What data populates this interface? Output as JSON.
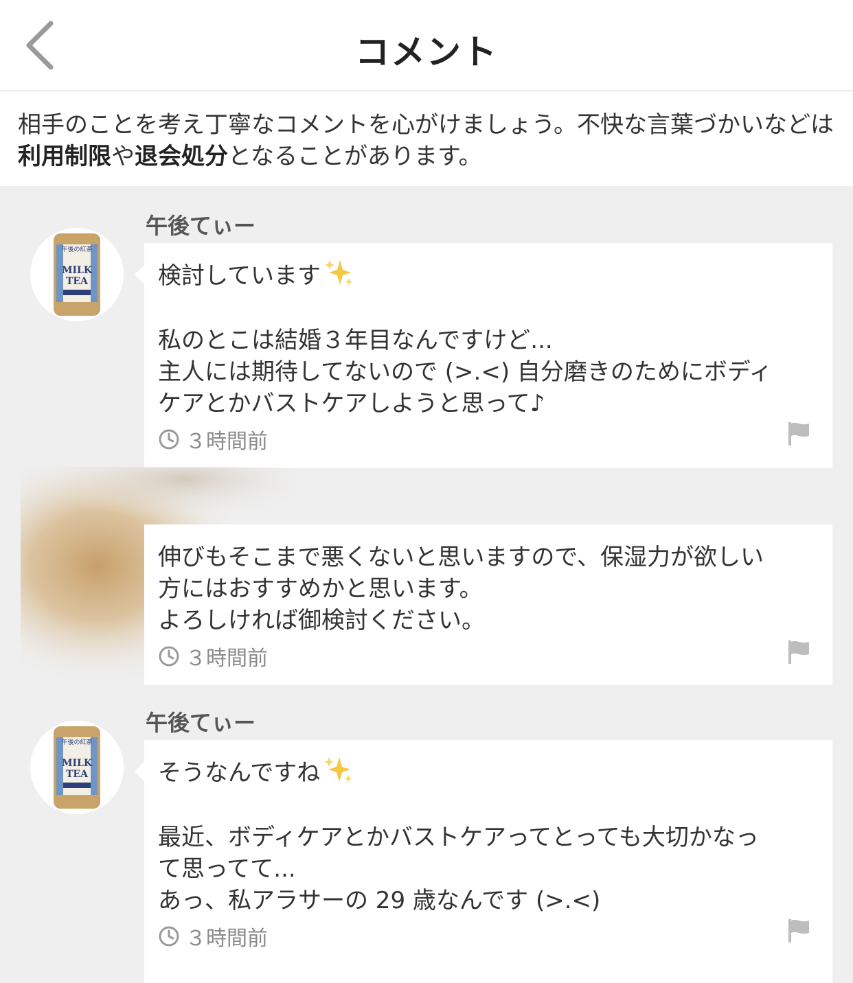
{
  "header": {
    "title": "コメント"
  },
  "notice": {
    "part1": "相手のことを考え丁寧なコメントを心がけましょう。不快な言葉づかいなどは",
    "bold1": "利用制限",
    "part2": "や",
    "bold2": "退会処分",
    "part3": "となることがあります。"
  },
  "comments": [
    {
      "author": "午後てぃー",
      "lines": [
        "検討しています",
        "",
        "私のとこは結婚３年目なんですけど...",
        "主人には期待してないので (>.<) 自分磨きのためにボディ",
        "ケアとかバストケアしようと思って♪"
      ],
      "time": "３時間前"
    },
    {
      "author": "",
      "lines": [
        "伸びもそこまで悪くないと思いますので、保湿力が欲しい",
        "方にはおすすめかと思います。",
        "よろしければ御検討ください。"
      ],
      "time": "３時間前"
    },
    {
      "author": "午後てぃー",
      "lines": [
        "そうなんですね",
        "",
        "最近、ボディケアとかバストケアってとっても大切かなっ",
        "て思ってて...",
        "あっ、私アラサーの 29 歳なんです (>.<)"
      ],
      "time": "３時間前"
    }
  ],
  "avatar_label": {
    "brand": "午後の紅茶",
    "product_line1": "MILK",
    "product_line2": "TEA"
  },
  "colors": {
    "background": "#efefef",
    "card": "#ffffff",
    "meta": "#8a8a8a",
    "accent_sparkle": "#f5c842",
    "avatar_gold": "#c9a46a"
  }
}
